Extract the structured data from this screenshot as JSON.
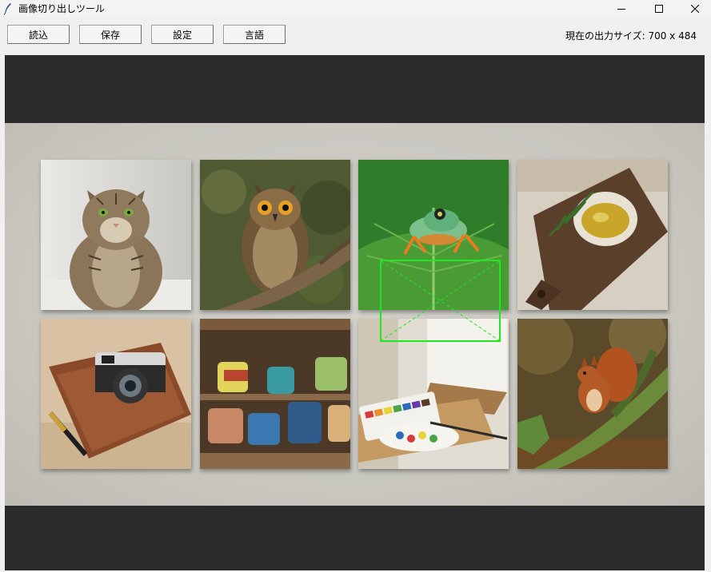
{
  "window": {
    "title": "画像切り出しツール",
    "icon": "feather-icon",
    "controls": [
      "minimize-icon",
      "maximize-icon",
      "close-icon"
    ]
  },
  "toolbar": {
    "load_label": "読込",
    "save_label": "保存",
    "settings_label": "設定",
    "language_label": "言語",
    "output_size": "現在の出力サイズ: 700 x 484"
  },
  "canvas": {
    "background": "#2b2b2b",
    "selection_color": "#1ee81e",
    "photos": [
      {
        "subject": "tabby-cat"
      },
      {
        "subject": "owl-on-branch"
      },
      {
        "subject": "green-frog-on-leaf"
      },
      {
        "subject": "olive-oil-on-cutting-board"
      },
      {
        "subject": "camera-and-notebook"
      },
      {
        "subject": "ceramic-mugs-on-shelf"
      },
      {
        "subject": "watercolor-palette-and-easel"
      },
      {
        "subject": "red-squirrel-on-mossy-branch"
      }
    ]
  }
}
